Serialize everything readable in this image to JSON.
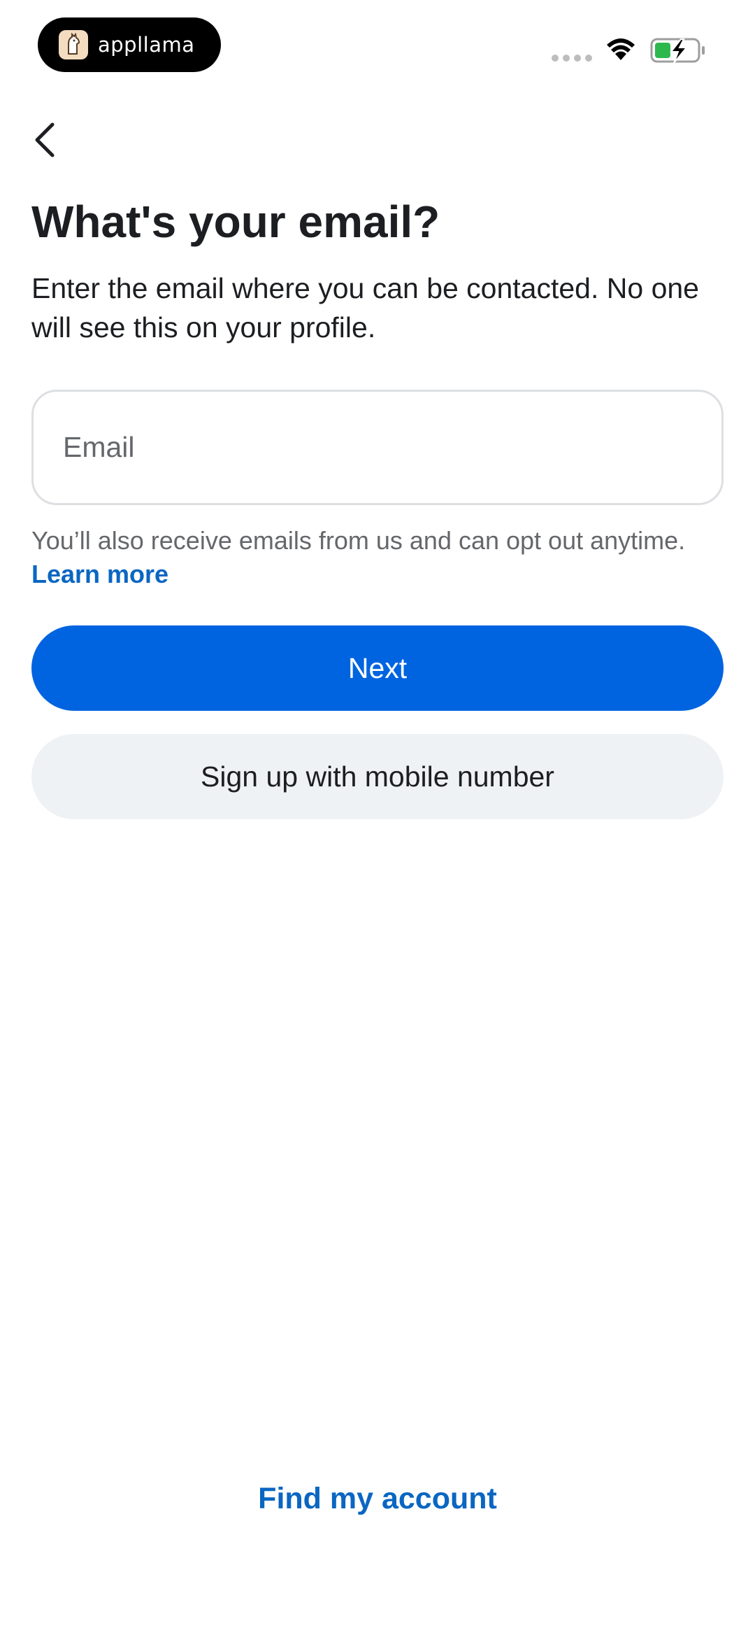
{
  "status_bar": {
    "app_name": "appllama",
    "icons": [
      "appllama-logo-icon",
      "signal-dots-icon",
      "wifi-icon",
      "battery-charging-icon"
    ],
    "battery_color": "#2db84d"
  },
  "header": {
    "back_icon": "chevron-left-icon"
  },
  "main": {
    "title": "What's your email?",
    "subtitle": "Enter the email where you can be contacted. No one will see this on your profile.",
    "email_field": {
      "placeholder": "Email",
      "value": ""
    },
    "helper_text": "You’ll also receive emails from us and can opt out anytime.",
    "learn_more_label": "Learn more",
    "next_label": "Next",
    "mobile_label": "Sign up with mobile number"
  },
  "footer": {
    "find_account_label": "Find my account"
  },
  "colors": {
    "primary": "#0064e0",
    "link": "#0a66c2",
    "secondary_button": "#eff2f4",
    "text": "#1c1e21",
    "muted_text": "#65676b"
  }
}
